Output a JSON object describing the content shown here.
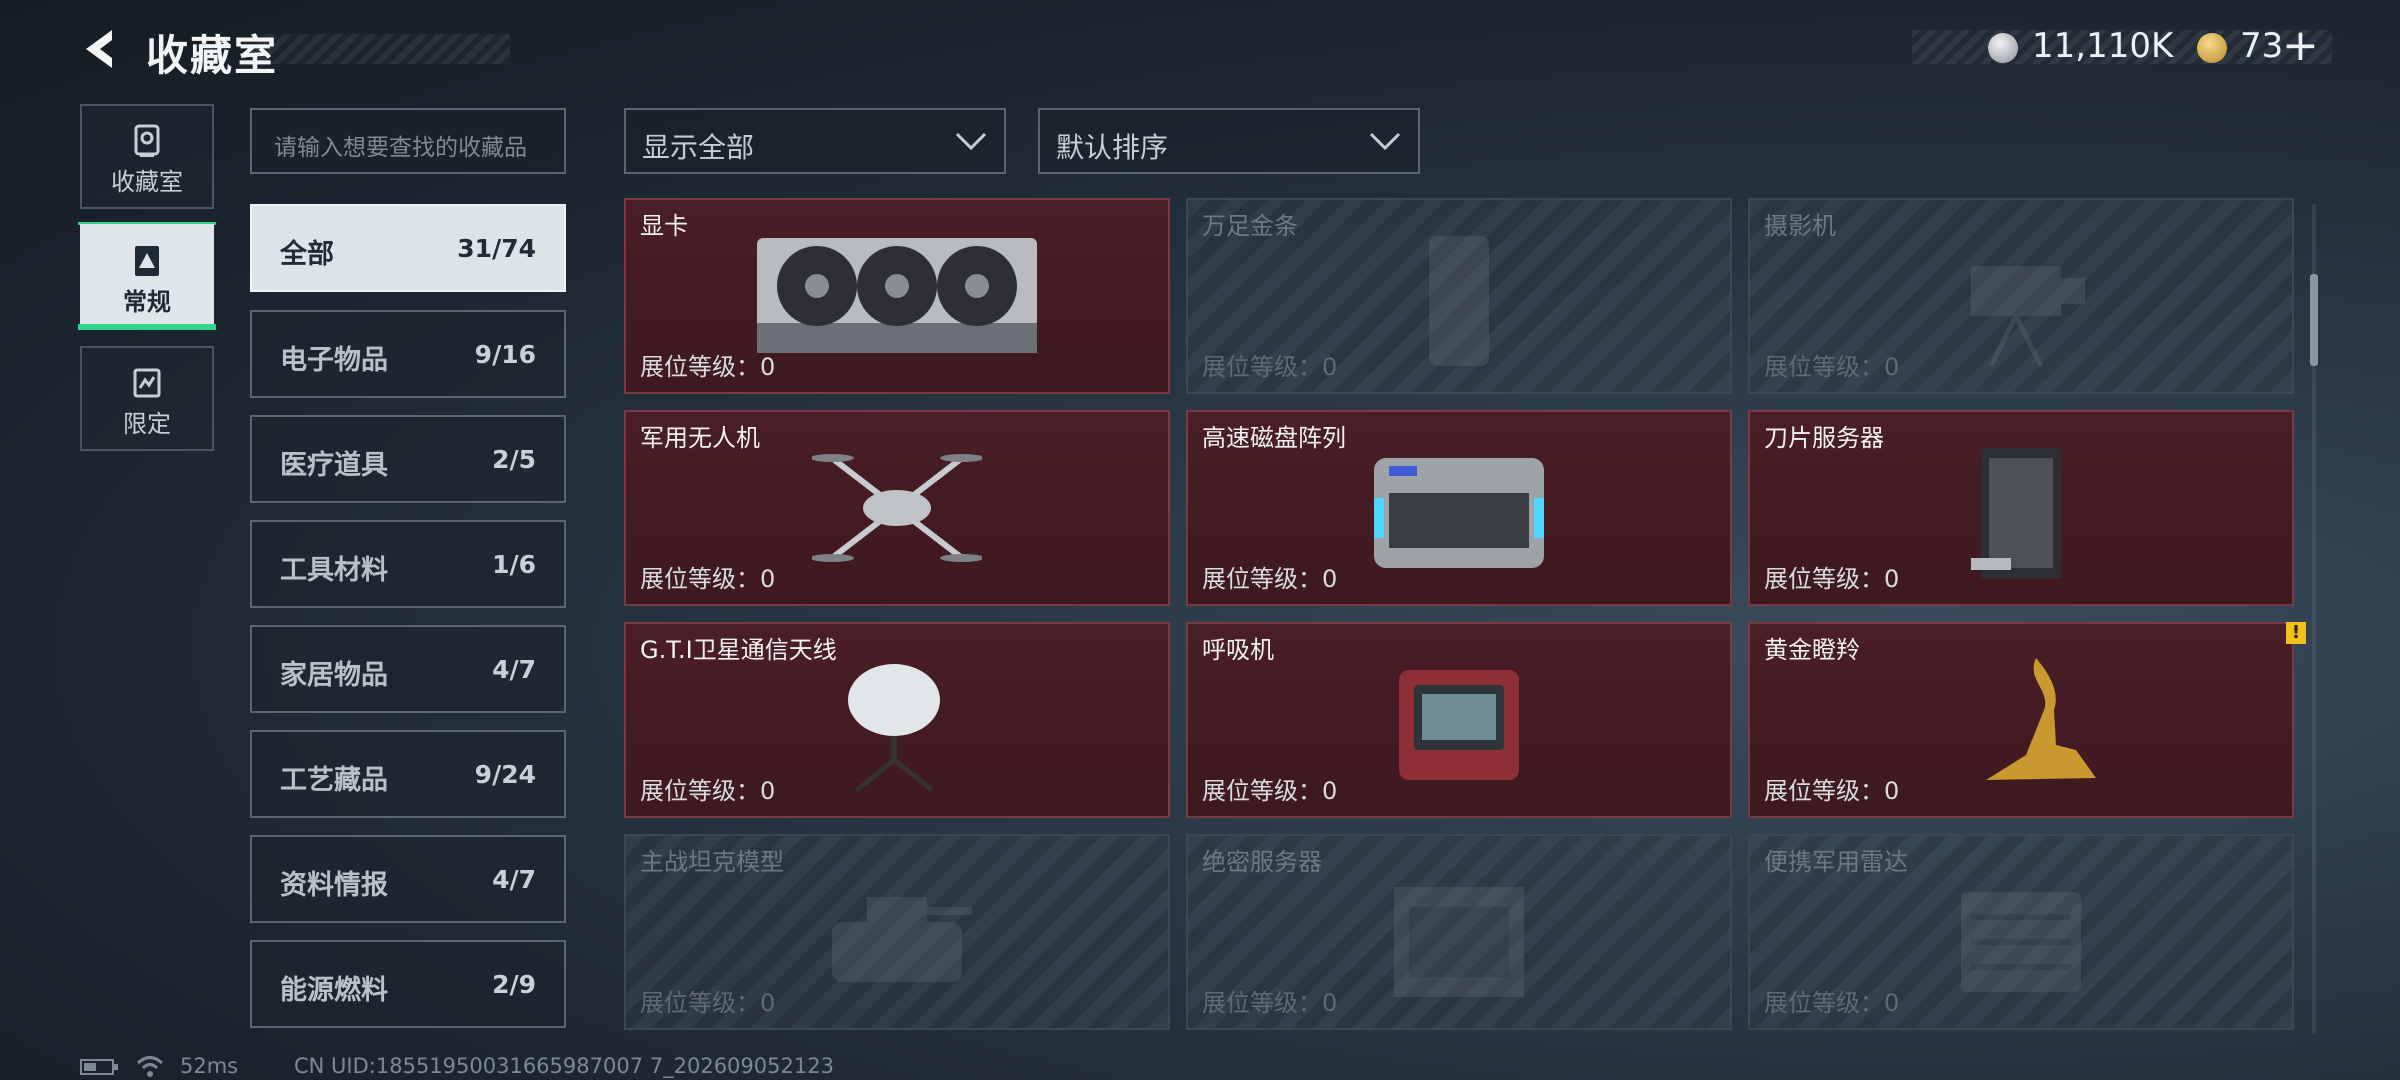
{
  "header": {
    "title": "收藏室",
    "currency1": "11,110K",
    "currency2": "73",
    "plus": "+"
  },
  "nav": [
    {
      "label": "收藏室",
      "icon": "vault-icon"
    },
    {
      "label": "常规",
      "icon": "regular-collection-icon"
    },
    {
      "label": "限定",
      "icon": "limited-collection-icon"
    }
  ],
  "search": {
    "placeholder": "请输入想要查找的收藏品"
  },
  "categories": [
    {
      "name": "全部",
      "count": "31/74"
    },
    {
      "name": "电子物品",
      "count": "9/16"
    },
    {
      "name": "医疗道具",
      "count": "2/5"
    },
    {
      "name": "工具材料",
      "count": "1/6"
    },
    {
      "name": "家居物品",
      "count": "4/7"
    },
    {
      "name": "工艺藏品",
      "count": "9/24"
    },
    {
      "name": "资料情报",
      "count": "4/7"
    },
    {
      "name": "能源燃料",
      "count": "2/9"
    }
  ],
  "filters": {
    "show": "显示全部",
    "sort": "默认排序"
  },
  "items": [
    {
      "name": "显卡",
      "level": "展位等级：0",
      "owned": true,
      "icon": "graphics-card-icon"
    },
    {
      "name": "万足金条",
      "level": "展位等级：0",
      "owned": false,
      "icon": "gold-bar-icon"
    },
    {
      "name": "摄影机",
      "level": "展位等级：0",
      "owned": false,
      "icon": "camera-icon"
    },
    {
      "name": "军用无人机",
      "level": "展位等级：0",
      "owned": true,
      "icon": "drone-icon"
    },
    {
      "name": "高速磁盘阵列",
      "level": "展位等级：0",
      "owned": true,
      "icon": "disk-array-icon"
    },
    {
      "name": "刀片服务器",
      "level": "展位等级：0",
      "owned": true,
      "icon": "blade-server-icon"
    },
    {
      "name": "G.T.I卫星通信天线",
      "level": "展位等级：0",
      "owned": true,
      "icon": "satellite-dish-icon"
    },
    {
      "name": "呼吸机",
      "level": "展位等级：0",
      "owned": true,
      "icon": "ventilator-icon"
    },
    {
      "name": "黄金瞪羚",
      "level": "展位等级：0",
      "owned": true,
      "icon": "golden-gazelle-icon",
      "warning": "!"
    },
    {
      "name": "主战坦克模型",
      "level": "展位等级：0",
      "owned": false,
      "icon": "tank-model-icon"
    },
    {
      "name": "绝密服务器",
      "level": "展位等级：0",
      "owned": false,
      "icon": "secret-server-icon"
    },
    {
      "name": "便携军用雷达",
      "level": "展位等级：0",
      "owned": false,
      "icon": "radar-icon"
    }
  ],
  "footer": {
    "ping": "52ms",
    "uid": "CN UID:18551950031665987007 7_202609052123"
  }
}
